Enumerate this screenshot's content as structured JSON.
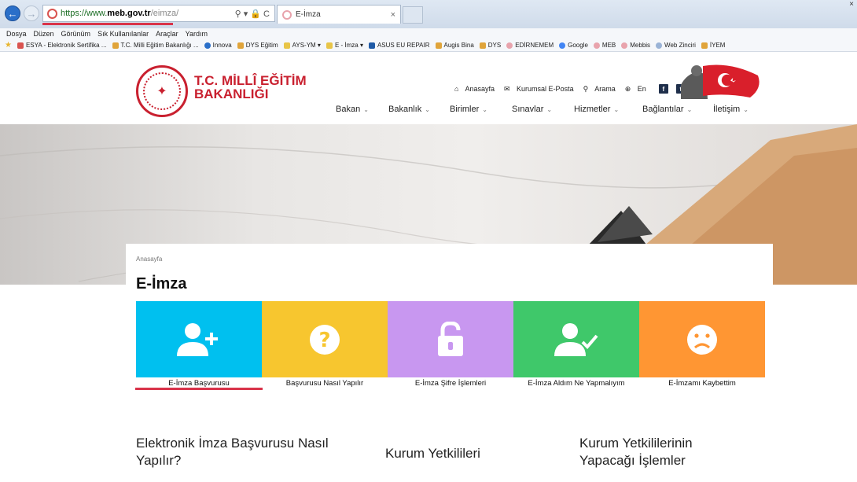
{
  "browser": {
    "url_scheme": "https://www.",
    "url_domain": "meb.gov.tr",
    "url_path": "/eimza/",
    "address_tools": "⚲ ▾ 🔒 C",
    "tab_title": "E-İmza",
    "tab_close": "×",
    "window_close": "×",
    "menu": [
      "Dosya",
      "Düzen",
      "Görünüm",
      "Sık Kullanılanlar",
      "Araçlar",
      "Yardım"
    ],
    "favorites": [
      {
        "label": "ESYA - Elektronik Sertifika ...",
        "color": "#d9534f"
      },
      {
        "label": "T.C. Milli Eğitim Bakanlığı ...",
        "color": "#e0a43a"
      },
      {
        "label": "Innova",
        "color": "#2a6fc9"
      },
      {
        "label": "DYS Eğitim",
        "color": "#e0a43a"
      },
      {
        "label": "AYS-YM ▾",
        "color": "#e8c547"
      },
      {
        "label": "E - İmza ▾",
        "color": "#e8c547"
      },
      {
        "label": "ASUS EU REPAIR",
        "color": "#1f5aa6"
      },
      {
        "label": "Augis Bina",
        "color": "#e0a43a"
      },
      {
        "label": "DYS",
        "color": "#e0a43a"
      },
      {
        "label": "EDİRNEMEM",
        "color": "#e8a3ac"
      },
      {
        "label": "Google",
        "color": "#4285f4"
      },
      {
        "label": "MEB",
        "color": "#e8a3ac"
      },
      {
        "label": "Mebbis",
        "color": "#e8a3ac"
      },
      {
        "label": "Web Zinciri",
        "color": "#9ab3d6"
      },
      {
        "label": "İYEM",
        "color": "#e0a43a"
      }
    ]
  },
  "site": {
    "logo_line1": "T.C. MİLLÎ EĞİTİM",
    "logo_line2": "BAKANLIĞI",
    "utility": {
      "home": "Anasayfa",
      "email": "Kurumsal E-Posta",
      "search": "Arama",
      "lang": "En"
    },
    "nav": [
      "Bakan",
      "Bakanlık",
      "Birimler",
      "Sınavlar",
      "Hizmetler",
      "Bağlantılar",
      "İletişim"
    ]
  },
  "page": {
    "breadcrumb": "Anasayfa",
    "title": "E-İmza",
    "tiles": [
      {
        "label": "E-İmza Başvurusu",
        "color": "#00c0ef",
        "icon": "user-add-icon"
      },
      {
        "label": "Başvurusu Nasıl Yapılır",
        "color": "#f7c62f",
        "icon": "question-icon"
      },
      {
        "label": "E-İmza Şifre İşlemleri",
        "color": "#c897f0",
        "icon": "unlock-icon"
      },
      {
        "label": "E-İmza Aldım Ne Yapmalıyım",
        "color": "#3fc86a",
        "icon": "user-check-icon"
      },
      {
        "label": "E-İmzamı Kaybettim",
        "color": "#ff9633",
        "icon": "sad-face-icon"
      }
    ],
    "columns": [
      {
        "line1": "Elektronik İmza Başvurusu Nasıl",
        "line2": "Yapılır?"
      },
      {
        "line1": "Kurum Yetkilileri",
        "line2": ""
      },
      {
        "line1": "Kurum Yetkililerinin",
        "line2": "Yapacağı İşlemler"
      }
    ]
  }
}
